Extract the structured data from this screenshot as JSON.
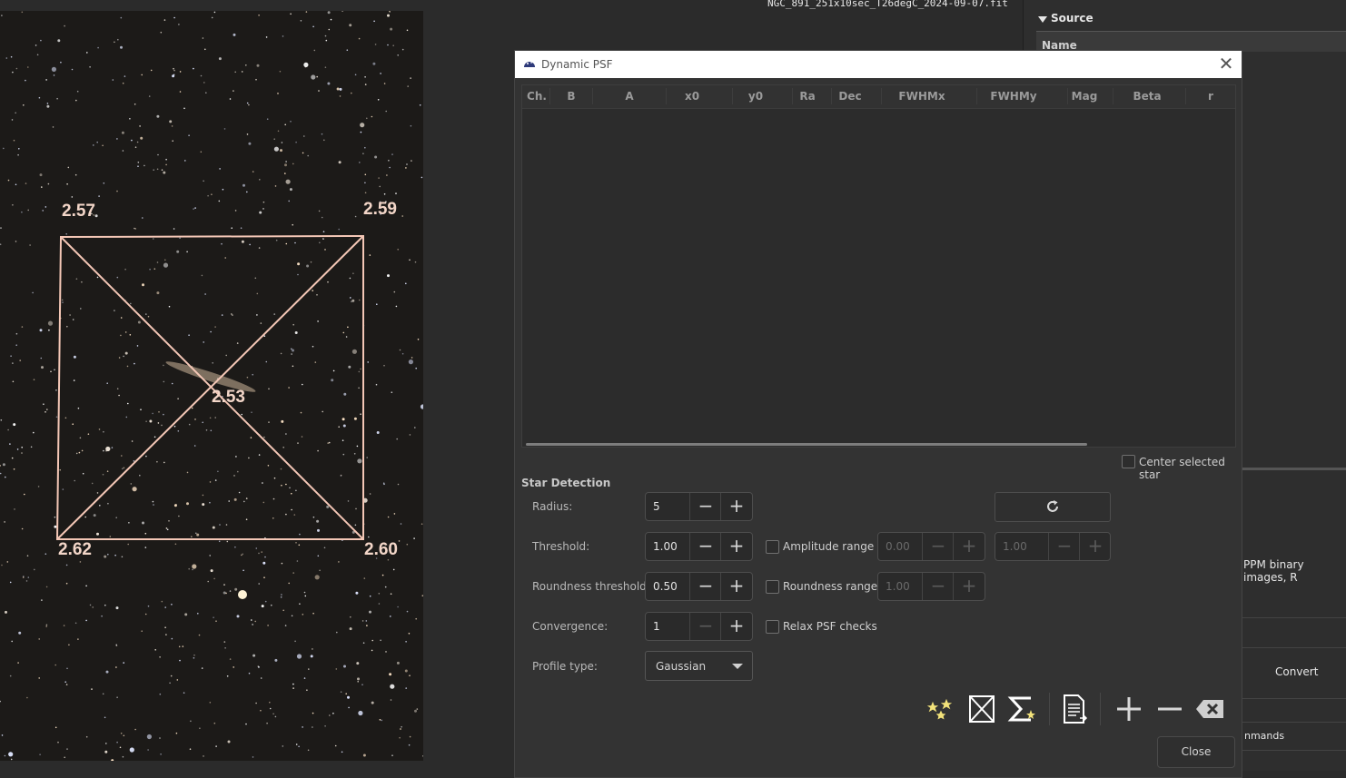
{
  "image": {
    "filename": "NGC_891_251x10sec_T26degC_2024-09-07.fit",
    "tilt_values": {
      "top_left": "2.57",
      "top_right": "2.59",
      "center": "2.53",
      "bottom_left": "2.62",
      "bottom_right": "2.60"
    }
  },
  "right_panel": {
    "source_header": "Source",
    "name_column": "Name",
    "format_text": "PPM binary images, R",
    "convert_button": "Convert",
    "commands_text": "nmands"
  },
  "dialog": {
    "title": "Dynamic PSF",
    "columns": [
      "Ch.",
      "B",
      "A",
      "x0",
      "y0",
      "Ra",
      "Dec",
      "FWHMx",
      "FWHMy",
      "Mag",
      "Beta",
      "r"
    ],
    "center_selected_star": "Center selected star",
    "star_detection": {
      "title": "Star Detection",
      "radius_label": "Radius:",
      "radius_value": "5",
      "threshold_label": "Threshold:",
      "threshold_value": "1.00",
      "roundness_threshold_label": "Roundness threshold:",
      "roundness_threshold_value": "0.50",
      "convergence_label": "Convergence:",
      "convergence_value": "1",
      "profile_type_label": "Profile type:",
      "profile_type_value": "Gaussian",
      "amplitude_range_label": "Amplitude range",
      "amplitude_min": "0.00",
      "amplitude_max": "1.00",
      "roundness_range_label": "Roundness range",
      "roundness_range_value": "1.00",
      "relax_psf_label": "Relax PSF checks"
    },
    "toolbar_icons": [
      "find-stars-icon",
      "tilt-icon",
      "average-icon",
      "export-icon",
      "add-icon",
      "remove-icon",
      "clear-icon"
    ],
    "close_button": "Close"
  },
  "colors": {
    "dialog_bg": "#333333",
    "tilt_lines": "#f6c9b9",
    "titlebar_bg": "#ffffff"
  }
}
